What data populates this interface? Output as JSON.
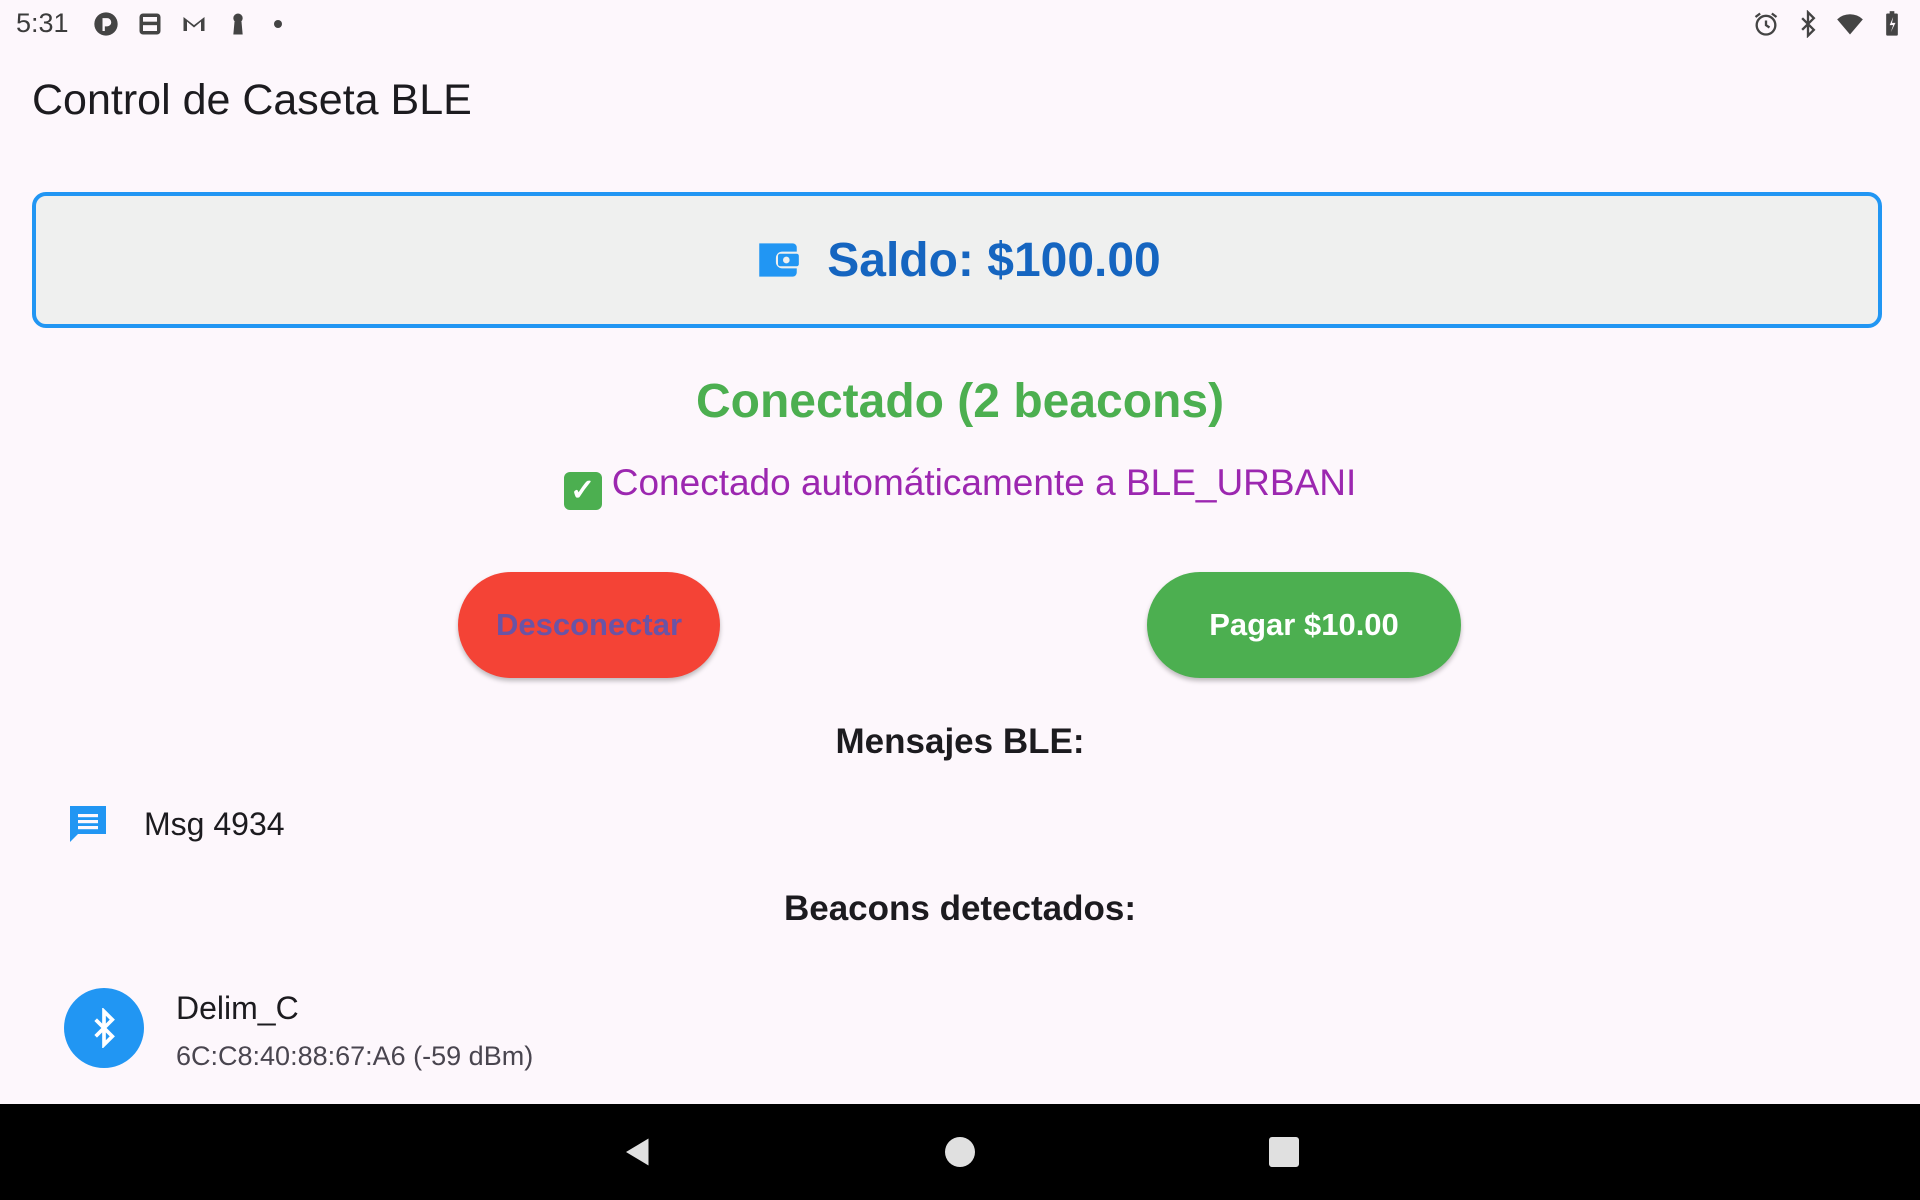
{
  "status_bar": {
    "time": "5:31",
    "left_icons": [
      "pocket-casts-icon",
      "screen-capture-icon",
      "gmail-icon",
      "keyhole-icon",
      "notification-dot-icon"
    ],
    "right_icons": [
      "alarm-icon",
      "bluetooth-icon",
      "wifi-icon",
      "battery-icon"
    ]
  },
  "app_bar": {
    "title": "Control de Caseta BLE"
  },
  "balance": {
    "icon": "wallet-icon",
    "text": "Saldo: $100.00"
  },
  "connection": {
    "status": "Conectado (2 beacons)",
    "auto_message": "Conectado automáticamente a BLE_URBANI",
    "check_icon": "check-mark-button-icon",
    "check_glyph": "✓"
  },
  "actions": {
    "disconnect_label": "Desconectar",
    "pay_label": "Pagar $10.00"
  },
  "messages": {
    "title": "Mensajes BLE:",
    "items": [
      {
        "icon": "message-icon",
        "text": "Msg 4934"
      }
    ]
  },
  "beacons": {
    "title": "Beacons detectados:",
    "items": [
      {
        "icon": "bluetooth-icon",
        "name": "Delim_C",
        "detail": "6C:C8:40:88:67:A6 (-59 dBm)"
      }
    ]
  },
  "nav_bar": {
    "buttons": [
      "back-icon",
      "home-icon",
      "recents-icon"
    ]
  },
  "colors": {
    "background": "#fdf7fc",
    "accent_blue": "#2196f3",
    "balance_text": "#1565c0",
    "connected_green": "#4caf50",
    "auto_message_purple": "#9c27b0",
    "disconnect_red": "#f44336",
    "pay_green": "#4caf50"
  }
}
